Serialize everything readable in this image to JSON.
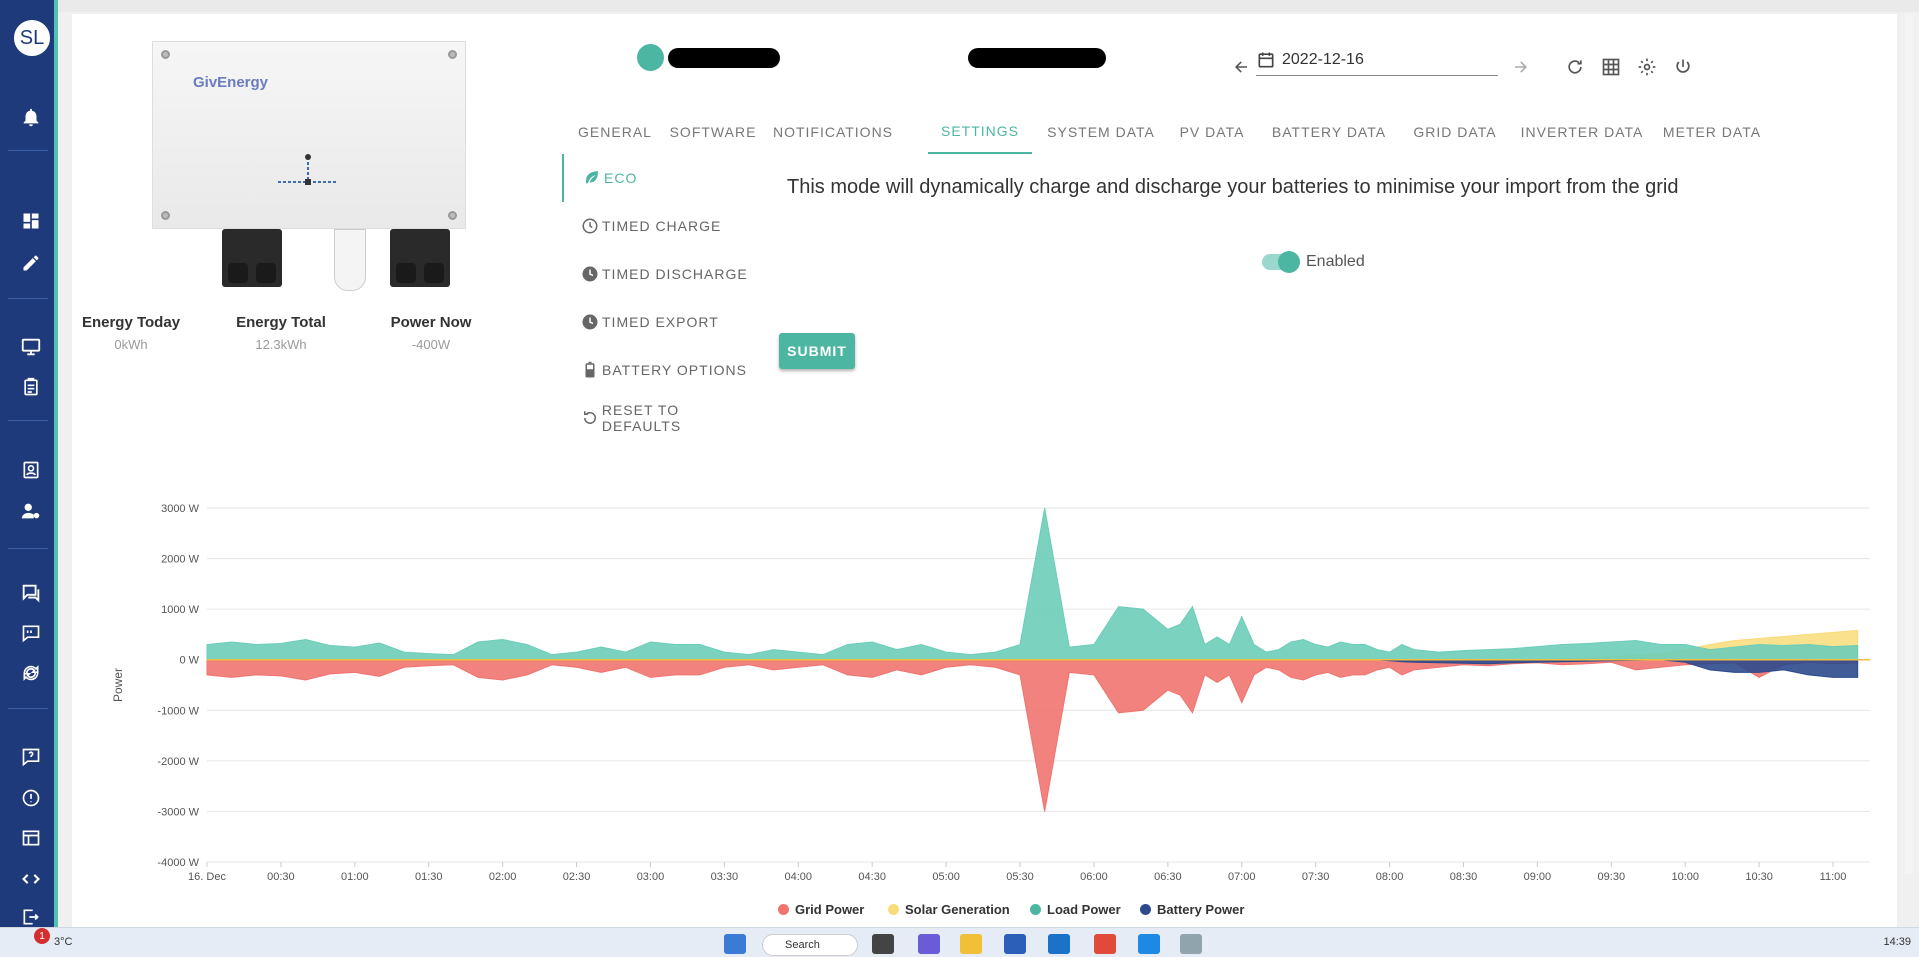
{
  "user": {
    "initials": "SL"
  },
  "inverter": {
    "brand": "GivEnergy"
  },
  "stats": [
    {
      "label": "Energy Today",
      "value": "0kWh"
    },
    {
      "label": "Energy Total",
      "value": "12.3kWh"
    },
    {
      "label": "Power Now",
      "value": "-400W"
    }
  ],
  "header": {
    "date": "2022-12-16"
  },
  "tabs": [
    "GENERAL",
    "SOFTWARE",
    "NOTIFICATIONS",
    "SETTINGS",
    "SYSTEM DATA",
    "PV DATA",
    "BATTERY DATA",
    "GRID DATA",
    "INVERTER DATA",
    "METER DATA"
  ],
  "active_tab": "SETTINGS",
  "settings_menu": [
    "ECO",
    "TIMED CHARGE",
    "TIMED DISCHARGE",
    "TIMED EXPORT",
    "BATTERY OPTIONS",
    "RESET TO DEFAULTS"
  ],
  "active_setting": "ECO",
  "eco": {
    "description": "This mode will dynamically charge and discharge your batteries to minimise your import from the grid",
    "toggle_label": "Enabled",
    "enabled": true,
    "submit_label": "SUBMIT"
  },
  "colors": {
    "accent": "#4db6a3",
    "nav": "#1f3a7a",
    "grid": "#f07470",
    "solar": "#f8dc7a",
    "load": "#6ccdb8",
    "battery": "#2c4a8c"
  },
  "chart_data": {
    "type": "area",
    "ylabel": "Power",
    "ylim": [
      -4000,
      3000
    ],
    "yticks": [
      3000,
      2000,
      1000,
      0,
      -1000,
      -2000,
      -3000,
      -4000
    ],
    "ytick_labels": [
      "3000 W",
      "2000 W",
      "1000 W",
      "0 W",
      "-1000 W",
      "-2000 W",
      "-3000 W",
      "-4000 W"
    ],
    "xtick_labels": [
      "16. Dec",
      "00:30",
      "01:00",
      "01:30",
      "02:00",
      "02:30",
      "03:00",
      "03:30",
      "04:00",
      "04:30",
      "05:00",
      "05:30",
      "06:00",
      "06:30",
      "07:00",
      "07:30",
      "08:00",
      "08:30",
      "09:00",
      "09:30",
      "10:00",
      "10:30",
      "11:00"
    ],
    "x_minutes": [
      0,
      10,
      20,
      30,
      40,
      50,
      60,
      70,
      80,
      90,
      100,
      110,
      120,
      130,
      140,
      150,
      160,
      170,
      180,
      190,
      200,
      210,
      220,
      230,
      240,
      250,
      260,
      270,
      280,
      290,
      300,
      310,
      320,
      330,
      340,
      350,
      360,
      370,
      380,
      390,
      395,
      400,
      405,
      410,
      415,
      420,
      425,
      430,
      435,
      440,
      445,
      450,
      455,
      460,
      465,
      470,
      475,
      480,
      485,
      490,
      500,
      510,
      520,
      530,
      540,
      550,
      560,
      570,
      580,
      590,
      600,
      610,
      620,
      630,
      640,
      650,
      660,
      670
    ],
    "series": [
      {
        "name": "Grid Power",
        "values": [
          -300,
          -350,
          -300,
          -320,
          -400,
          -280,
          -250,
          -330,
          -150,
          -120,
          -100,
          -350,
          -400,
          -300,
          -100,
          -150,
          -250,
          -150,
          -350,
          -300,
          -300,
          -150,
          -100,
          -200,
          -150,
          -100,
          -300,
          -350,
          -200,
          -300,
          -150,
          -100,
          -150,
          -300,
          -3000,
          -250,
          -300,
          -1050,
          -1000,
          -600,
          -700,
          -1050,
          -300,
          -450,
          -300,
          -850,
          -300,
          -150,
          -200,
          -350,
          -400,
          -300,
          -250,
          -350,
          -300,
          -300,
          -200,
          -150,
          -300,
          -200,
          -150,
          -100,
          -120,
          -80,
          -60,
          -100,
          -80,
          -50,
          -200,
          -150,
          -100,
          -80,
          -60,
          -350,
          -100,
          -50,
          -80,
          -60
        ]
      },
      {
        "name": "Solar Generation",
        "values": [
          0,
          0,
          0,
          0,
          0,
          0,
          0,
          0,
          0,
          0,
          0,
          0,
          0,
          0,
          0,
          0,
          0,
          0,
          0,
          0,
          0,
          0,
          0,
          0,
          0,
          0,
          0,
          0,
          0,
          0,
          0,
          0,
          0,
          0,
          0,
          0,
          0,
          0,
          0,
          0,
          0,
          0,
          0,
          0,
          0,
          0,
          0,
          0,
          0,
          0,
          0,
          0,
          0,
          0,
          0,
          0,
          0,
          0,
          0,
          0,
          0,
          0,
          0,
          0,
          0,
          20,
          40,
          60,
          80,
          120,
          200,
          300,
          380,
          420,
          460,
          500,
          540,
          580
        ]
      },
      {
        "name": "Load Power",
        "values": [
          300,
          350,
          300,
          320,
          400,
          280,
          250,
          330,
          150,
          120,
          100,
          350,
          400,
          300,
          100,
          150,
          250,
          150,
          350,
          300,
          300,
          150,
          100,
          200,
          150,
          100,
          300,
          350,
          200,
          300,
          150,
          100,
          150,
          300,
          3000,
          250,
          300,
          1050,
          1000,
          600,
          700,
          1050,
          300,
          450,
          300,
          850,
          300,
          150,
          200,
          350,
          400,
          300,
          250,
          350,
          300,
          300,
          200,
          150,
          300,
          200,
          150,
          180,
          200,
          220,
          260,
          300,
          320,
          350,
          380,
          300,
          300,
          200,
          250,
          300,
          280,
          300,
          260,
          280
        ]
      },
      {
        "name": "Battery Power",
        "values": [
          0,
          0,
          0,
          0,
          0,
          0,
          0,
          0,
          0,
          0,
          0,
          0,
          0,
          0,
          0,
          0,
          0,
          0,
          0,
          0,
          0,
          0,
          0,
          0,
          0,
          0,
          0,
          0,
          0,
          0,
          0,
          0,
          0,
          0,
          0,
          0,
          0,
          0,
          0,
          0,
          0,
          0,
          0,
          0,
          0,
          0,
          0,
          0,
          0,
          0,
          0,
          0,
          0,
          0,
          0,
          0,
          0,
          -20,
          -40,
          -50,
          -60,
          -70,
          -80,
          -60,
          -50,
          -40,
          -30,
          -20,
          -10,
          0,
          -50,
          -200,
          -250,
          -250,
          -200,
          -300,
          -350,
          -350
        ]
      }
    ]
  }
}
